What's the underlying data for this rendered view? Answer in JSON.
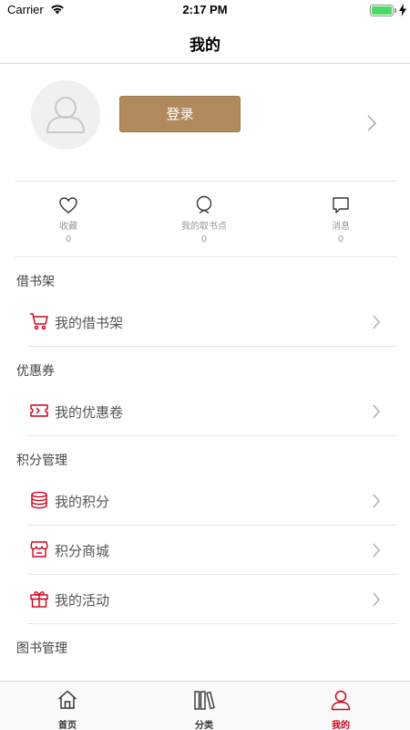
{
  "status_bar": {
    "carrier": "Carrier",
    "time": "2:17 PM"
  },
  "nav": {
    "title": "我的"
  },
  "profile": {
    "login_label": "登录",
    "avatar_icon": "user-placeholder-icon"
  },
  "stats": [
    {
      "label": "收藏",
      "count": "0",
      "icon": "heart-icon"
    },
    {
      "label": "我的取书点",
      "count": "0",
      "icon": "location-pin-icon"
    },
    {
      "label": "消息",
      "count": "0",
      "icon": "message-icon"
    }
  ],
  "sections": {
    "borrow": {
      "title": "借书架",
      "items": [
        {
          "label": "我的借书架",
          "icon": "cart-icon"
        }
      ]
    },
    "coupon": {
      "title": "优惠券",
      "items": [
        {
          "label": "我的优惠卷",
          "icon": "ticket-icon"
        }
      ]
    },
    "points": {
      "title": "积分管理",
      "items": [
        {
          "label": "我的积分",
          "icon": "coins-icon"
        },
        {
          "label": "积分商城",
          "icon": "shop-icon"
        },
        {
          "label": "我的活动",
          "icon": "gift-icon"
        }
      ]
    },
    "books": {
      "title": "图书管理"
    }
  },
  "tabs": [
    {
      "label": "首页",
      "icon": "home-icon",
      "active": false
    },
    {
      "label": "分类",
      "icon": "books-icon",
      "active": false
    },
    {
      "label": "我的",
      "icon": "profile-icon",
      "active": true
    }
  ],
  "colors": {
    "accent": "#d0021b",
    "login_button": "#b08a5c",
    "battery": "#4cd964"
  }
}
